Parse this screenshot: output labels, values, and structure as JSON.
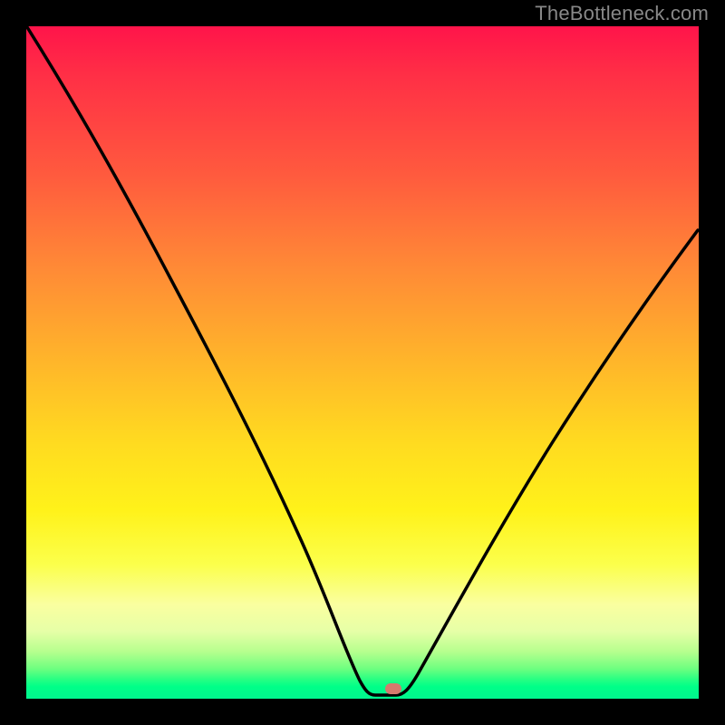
{
  "watermark": {
    "text": "TheBottleneck.com"
  },
  "colors": {
    "frame": "#000000",
    "gradient": [
      "#ff144a",
      "#ff5a3e",
      "#ffb62a",
      "#fff21a",
      "#faffa0",
      "#00ff88"
    ],
    "curve": "#000000",
    "marker": "#d47a6d"
  },
  "chart_data": {
    "type": "line",
    "title": "",
    "xlabel": "",
    "ylabel": "",
    "xlim": [
      0,
      100
    ],
    "ylim": [
      0,
      100
    ],
    "grid": false,
    "legend": false,
    "annotations": [
      {
        "text": "TheBottleneck.com",
        "position": "top-right"
      }
    ],
    "marker": {
      "x": 54,
      "y": 2,
      "shape": "pill",
      "color": "#d47a6d"
    },
    "series": [
      {
        "name": "bottleneck-curve",
        "x": [
          0,
          5,
          10,
          15,
          20,
          25,
          30,
          35,
          40,
          45,
          48,
          50,
          52,
          54,
          56,
          58,
          62,
          68,
          74,
          80,
          86,
          92,
          100
        ],
        "y": [
          100,
          93,
          85,
          76,
          67,
          58,
          49,
          40,
          30,
          19,
          11,
          6,
          3,
          2,
          2,
          3,
          7,
          15,
          24,
          33,
          42,
          50,
          60
        ]
      }
    ]
  }
}
